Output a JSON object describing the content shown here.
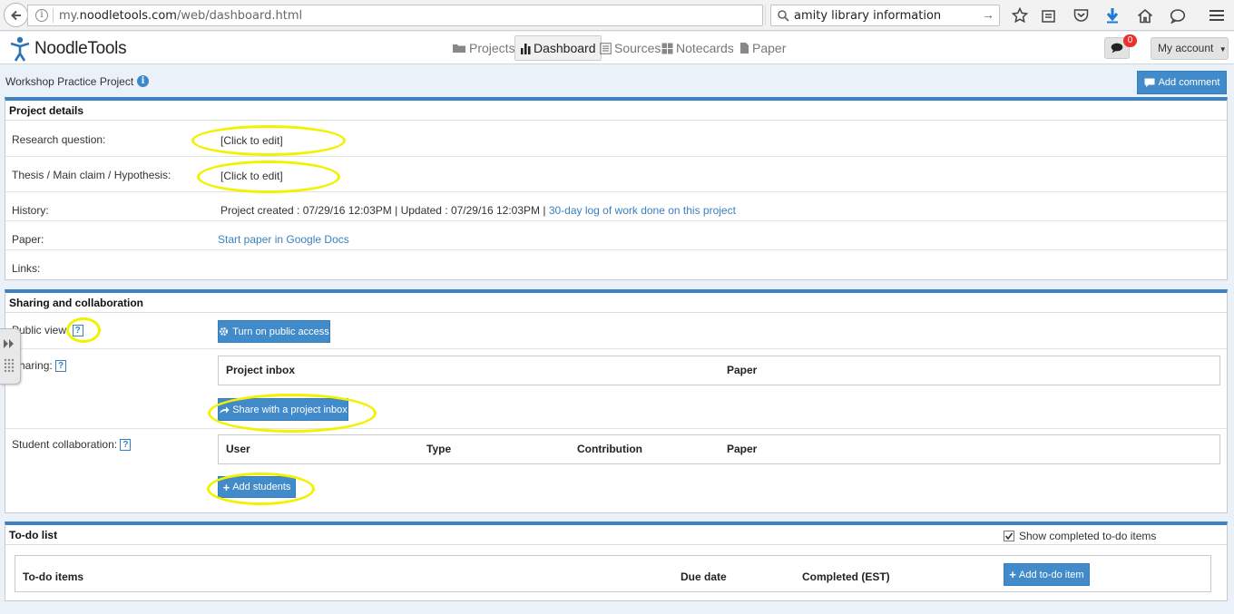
{
  "browser": {
    "url_prefix": "my.",
    "url_domain": "noodletools.com",
    "url_path": "/web/dashboard.html",
    "search_query": "amity library information"
  },
  "app": {
    "logo_text": "NoodleTools",
    "nav": [
      {
        "label": "Projects",
        "icon": "folder-icon"
      },
      {
        "label": "Dashboard",
        "icon": "bar-chart-icon",
        "active": true
      },
      {
        "label": "Sources",
        "icon": "list-icon"
      },
      {
        "label": "Notecards",
        "icon": "grid-icon"
      },
      {
        "label": "Paper",
        "icon": "document-icon"
      }
    ],
    "notification_count": "0",
    "account_label": "My account"
  },
  "project": {
    "title": "Workshop Practice Project",
    "add_comment_label": "Add comment"
  },
  "project_details": {
    "heading": "Project details",
    "research_question_label": "Research question:",
    "research_question_value": "[Click to edit]",
    "thesis_label": "Thesis / Main claim / Hypothesis:",
    "thesis_value": "[Click to edit]",
    "history_label": "History:",
    "history_text": "Project created : 07/29/16 12:03PM | Updated : 07/29/16 12:03PM |",
    "history_link": "30-day log of work done on this project",
    "paper_label": "Paper:",
    "paper_link": "Start paper in Google Docs",
    "links_label": "Links:"
  },
  "sharing": {
    "heading": "Sharing and collaboration",
    "public_view_label": "Public view:",
    "public_access_button": "Turn on public access",
    "sharing_label": "Sharing:",
    "sharing_columns": [
      "Project inbox",
      "Paper"
    ],
    "share_button": "Share with a project inbox",
    "collab_label": "Student collaboration:",
    "collab_columns": [
      "User",
      "Type",
      "Contribution",
      "Paper"
    ],
    "add_students_button": "Add students"
  },
  "todo": {
    "heading": "To-do list",
    "show_completed_label": "Show completed to-do items",
    "show_completed_checked": true,
    "columns": [
      "To-do items",
      "Due date",
      "Completed (EST)"
    ],
    "add_button": "Add to-do item"
  },
  "colors": {
    "accent": "#3c83c3",
    "button": "#428bca",
    "highlight": "#f2f200",
    "link": "#3a7fc1"
  }
}
